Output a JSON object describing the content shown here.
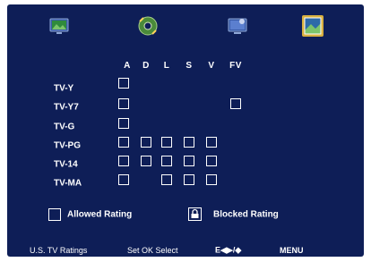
{
  "tabs": [
    {
      "icon": "tv-picture-icon",
      "selected": false
    },
    {
      "icon": "sound-disc-icon",
      "selected": false
    },
    {
      "icon": "tv-setup-icon",
      "selected": false
    },
    {
      "icon": "parental-lock-icon",
      "selected": true
    }
  ],
  "grid": {
    "columns": [
      "A",
      "D",
      "L",
      "S",
      "V",
      "FV"
    ],
    "rows": [
      {
        "label": "TV-Y",
        "cells": [
          true,
          false,
          false,
          false,
          false,
          false
        ]
      },
      {
        "label": "TV-Y7",
        "cells": [
          true,
          false,
          false,
          false,
          false,
          true
        ]
      },
      {
        "label": "TV-G",
        "cells": [
          true,
          false,
          false,
          false,
          false,
          false
        ]
      },
      {
        "label": "TV-PG",
        "cells": [
          true,
          true,
          true,
          true,
          true,
          false
        ]
      },
      {
        "label": "TV-14",
        "cells": [
          true,
          true,
          true,
          true,
          true,
          false
        ]
      },
      {
        "label": "TV-MA",
        "cells": [
          true,
          false,
          true,
          true,
          true,
          false
        ]
      }
    ]
  },
  "legend": {
    "allowed_label": "Allowed Rating",
    "blocked_label": "Blocked Rating"
  },
  "footer": {
    "page_title": "U.S. TV Ratings",
    "select_hint": "Set OK Select",
    "nav_hint": "E◀▶/◆",
    "menu_label": "MENU"
  },
  "colors": {
    "background": "#0e1e57",
    "text": "#ffffff"
  }
}
